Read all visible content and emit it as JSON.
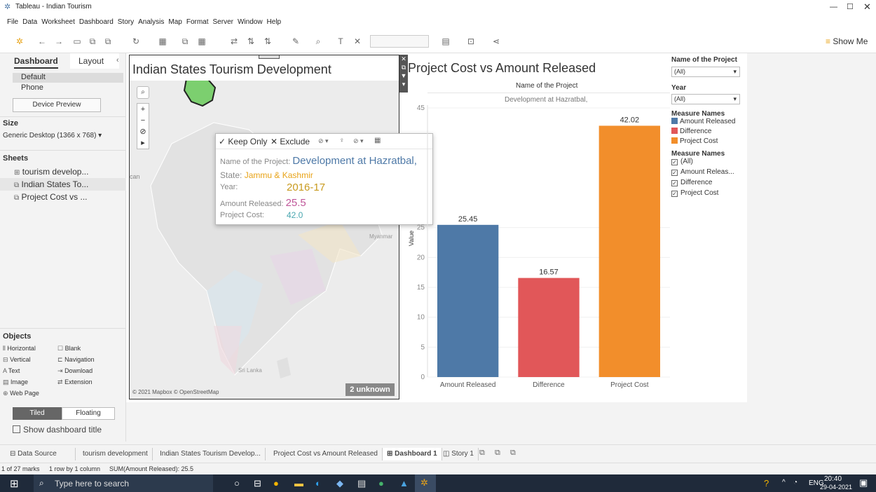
{
  "window": {
    "title": "Tableau - Indian Tourism"
  },
  "menu": [
    "File",
    "Data",
    "Worksheet",
    "Dashboard",
    "Story",
    "Analysis",
    "Map",
    "Format",
    "Server",
    "Window",
    "Help"
  ],
  "toolbar": {
    "show_me": "Show Me"
  },
  "left": {
    "tabs": [
      "Dashboard",
      "Layout"
    ],
    "devices": [
      "Default",
      "Phone"
    ],
    "device_preview": "Device Preview",
    "size_h": "Size",
    "size_value": "Generic Desktop (1366 x 768)",
    "sheets_h": "Sheets",
    "sheets": [
      "tourism develop...",
      "Indian States To...",
      "Project Cost vs ..."
    ],
    "objects_h": "Objects",
    "objects": [
      "Horizontal",
      "Blank",
      "Vertical",
      "Navigation",
      "Text",
      "Download",
      "Image",
      "Extension",
      "Web Page"
    ],
    "tiled": "Tiled",
    "floating": "Floating",
    "show_title": "Show dashboard title"
  },
  "map": {
    "title": "Indian States Tourism Development",
    "labels": {
      "myanmar": "Myanmar",
      "srilanka": "Sri Lanka",
      "can": "can"
    },
    "attribution": "© 2021 Mapbox © OpenStreetMap",
    "unknown": "2 unknown"
  },
  "tooltip": {
    "keep": "✓ Keep Only",
    "exclude": "✕ Exclude",
    "project_label": "Name of the Project:",
    "project": "Development at Hazratbal,",
    "state_label": "State:",
    "state": "Jammu & Kashmir",
    "year_label": "Year:",
    "year": "2016-17",
    "released_label": "Amount Released:",
    "released": "25.5",
    "cost_label": "Project Cost:",
    "cost": "42.0"
  },
  "chart": {
    "title": "Project Cost vs Amount Released",
    "header": "Name of the Project",
    "sub": "Development at Hazratbal,",
    "ylabel": "Value",
    "value_labels": [
      "25.45",
      "16.57",
      "42.02"
    ]
  },
  "chart_data": {
    "type": "bar",
    "categories": [
      "Amount Released",
      "Difference",
      "Project Cost"
    ],
    "values": [
      25.45,
      16.57,
      42.02
    ],
    "colors": [
      "#4e79a7",
      "#e15759",
      "#f28e2b"
    ],
    "yticks": [
      0,
      5,
      10,
      15,
      20,
      25,
      45
    ],
    "ylim": [
      0,
      45
    ],
    "ylabel": "Value"
  },
  "legend": {
    "f1": "Name of the Project",
    "f1v": "(All)",
    "f2": "Year",
    "f2v": "(All)",
    "mn": "Measure Names",
    "items": [
      "Amount Released",
      "Difference",
      "Project Cost"
    ],
    "colors": [
      "#4e79a7",
      "#e15759",
      "#f28e2b"
    ],
    "mn2": "Measure Names",
    "checks": [
      "(All)",
      "Amount Releas...",
      "Difference",
      "Project Cost"
    ]
  },
  "tabs": [
    "Data Source",
    "tourism development",
    "Indian States Tourism Develop...",
    "Project Cost vs Amount Released",
    "Dashboard 1",
    "Story 1"
  ],
  "status": {
    "marks": "1 of 27 marks",
    "rows": "1 row by 1 column",
    "sum": "SUM(Amount Released): 25.5"
  },
  "taskbar": {
    "search": "Type here to search",
    "time": "20:40",
    "date": "29-04-2021",
    "lang": "ENG"
  }
}
